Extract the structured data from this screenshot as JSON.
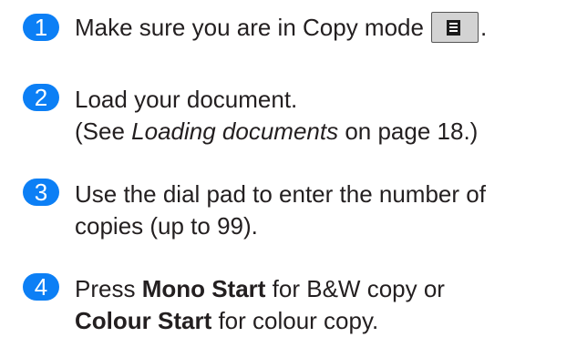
{
  "steps": [
    {
      "number": "1",
      "line1": "Make sure you are in Copy mode",
      "copy_key_icon": "copy-mode-icon",
      "period": "."
    },
    {
      "number": "2",
      "line1": "Load your document.",
      "line2_prefix": "(See ",
      "line2_link": "Loading documents",
      "line2_suffix": " on page 18.)"
    },
    {
      "number": "3",
      "line1": "Use the dial pad to enter the number of",
      "line2": "copies (up to 99)."
    },
    {
      "number": "4",
      "line1_bold": "Mono Start",
      "line1_rest": " for B&W copy or",
      "line1_prefix": "Press ",
      "line2_bold": "Colour Start",
      "line2_rest": " for colour copy."
    }
  ],
  "colors": {
    "badge": "#0c7ff5",
    "text": "#231f20",
    "copy_key_bg": "#d3d3d3"
  }
}
